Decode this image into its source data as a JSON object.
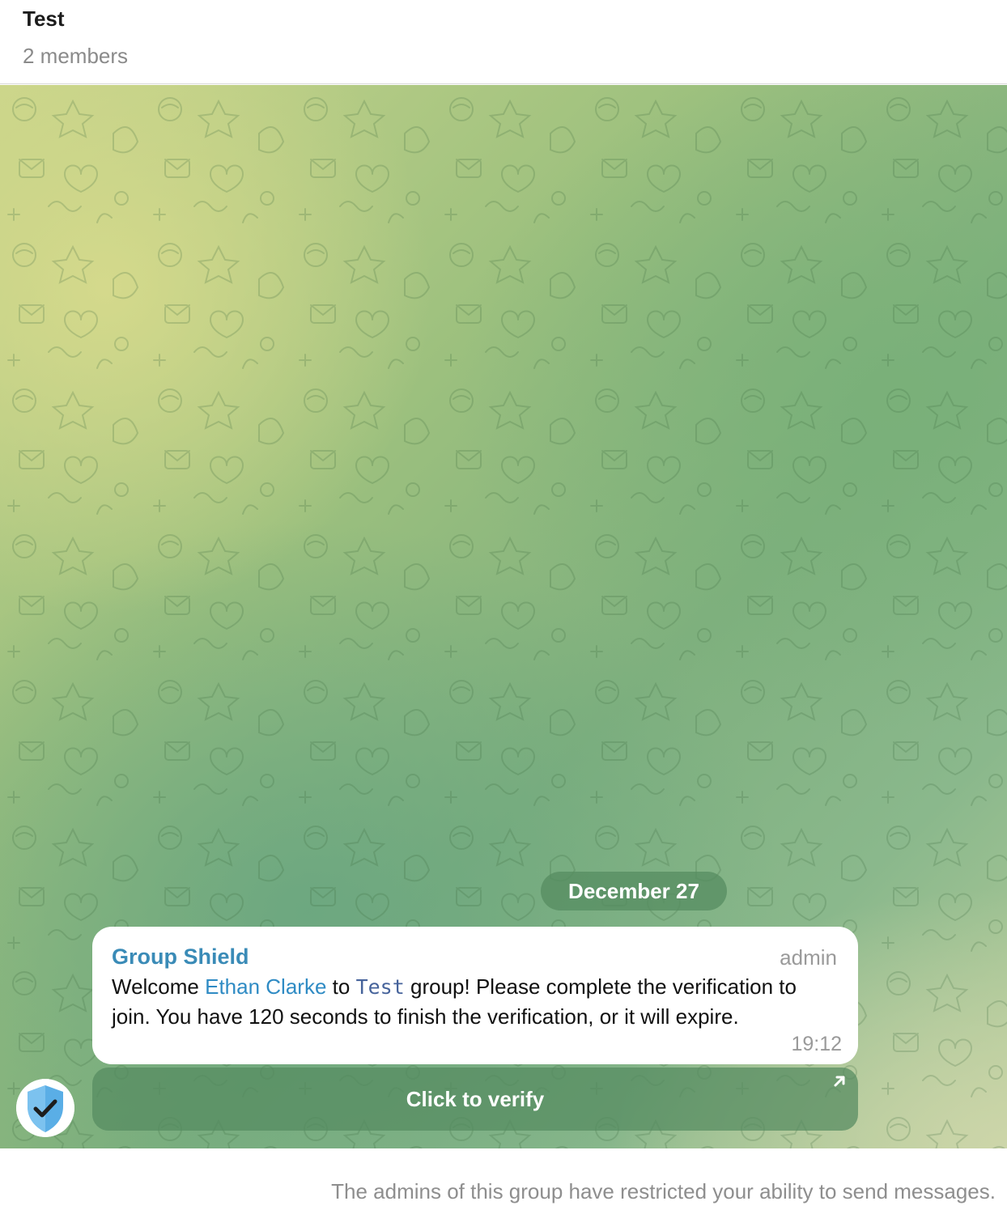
{
  "header": {
    "title": "Test",
    "subtitle": "2 members"
  },
  "chat": {
    "date_separator": "December 27",
    "message": {
      "sender": "Group Shield",
      "role": "admin",
      "text_welcome": "Welcome ",
      "mention": "Ethan Clarke",
      "text_to": " to ",
      "code": "Test",
      "text_rest": " group! Please complete the verification to join. You have 120 seconds to finish the verification, or it will expire.",
      "time": "19:12",
      "avatar_icon": "shield-check-icon"
    },
    "inline_button": {
      "label": "Click to verify",
      "icon": "open-link-arrow-icon"
    }
  },
  "footer": {
    "notice": "The admins of this group have restricted your ability to send messages."
  },
  "colors": {
    "sender_name": "#3a8bb7",
    "mention": "#2f8bc4",
    "shield_blue": "#5aaee6"
  }
}
